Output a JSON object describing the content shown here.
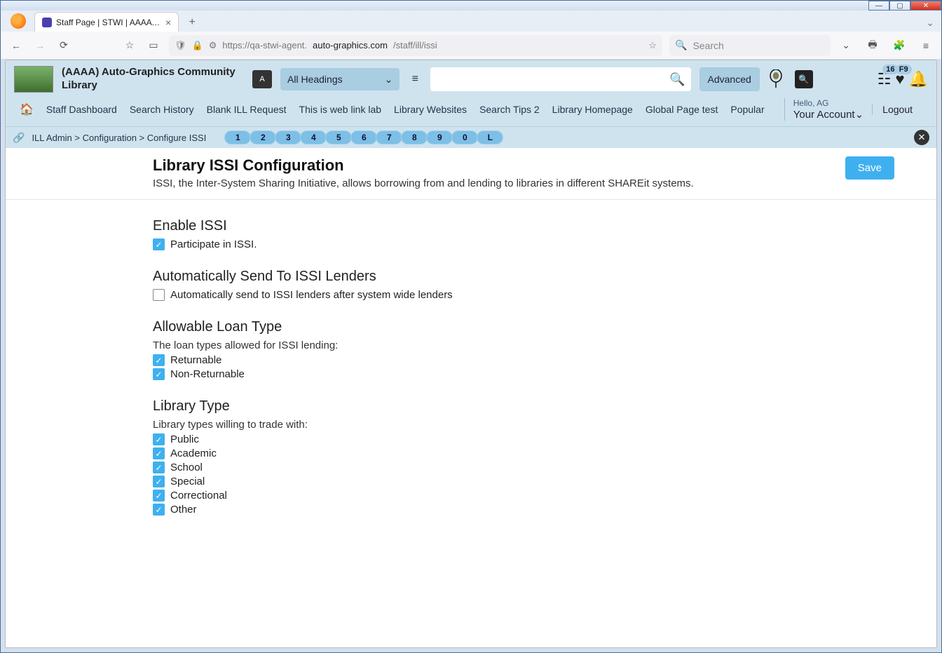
{
  "browser": {
    "tab_title": "Staff Page | STWI | AAAA | Auto…",
    "url_prefix": "https://qa-stwi-agent.",
    "url_domain": "auto-graphics.com",
    "url_path": "/staff/ill/issi",
    "search_placeholder": "Search"
  },
  "header": {
    "library_name": "(AAAA) Auto-Graphics Community Library",
    "headings_dropdown": "All Headings",
    "advanced": "Advanced",
    "hello": "Hello, AG",
    "account": "Your Account",
    "logout": "Logout",
    "badge_list": "16",
    "badge_heart": "F9"
  },
  "nav": {
    "items": [
      "Staff Dashboard",
      "Search History",
      "Blank ILL Request",
      "This is web link lab",
      "Library Websites",
      "Search Tips 2",
      "Library Homepage",
      "Global Page test",
      "Popular"
    ]
  },
  "breadcrumb": {
    "a": "ILL Admin",
    "b": "Configuration",
    "c": "Configure ISSI",
    "pills": [
      "1",
      "2",
      "3",
      "4",
      "5",
      "6",
      "7",
      "8",
      "9",
      "0",
      "L"
    ]
  },
  "page": {
    "title": "Library ISSI Configuration",
    "subtitle": "ISSI, the Inter-System Sharing Initiative, allows borrowing from and lending to libraries in different SHAREit systems.",
    "save": "Save"
  },
  "sections": {
    "enable": {
      "title": "Enable ISSI",
      "opt": "Participate in ISSI."
    },
    "autosend": {
      "title": "Automatically Send To ISSI Lenders",
      "opt": "Automatically send to ISSI lenders after system wide lenders"
    },
    "loan": {
      "title": "Allowable Loan Type",
      "sub": "The loan types allowed for ISSI lending:",
      "opts": [
        "Returnable",
        "Non-Returnable"
      ]
    },
    "libtype": {
      "title": "Library Type",
      "sub": "Library types willing to trade with:",
      "opts": [
        "Public",
        "Academic",
        "School",
        "Special",
        "Correctional",
        "Other"
      ]
    }
  }
}
